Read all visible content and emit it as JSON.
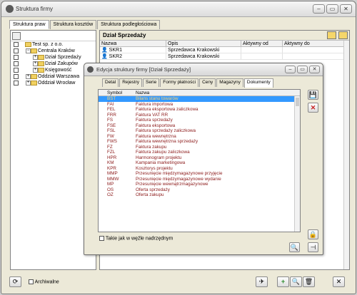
{
  "window": {
    "title": "Struktura firmy",
    "controls": [
      "–",
      "▭",
      "✕"
    ]
  },
  "tabs": [
    "Struktura praw",
    "Struktura kosztów",
    "Struktura podległościowa"
  ],
  "tree": [
    {
      "label": "Test sp. z o.o.",
      "level": 0,
      "expander": ""
    },
    {
      "label": "Centrala Kraków",
      "level": 1,
      "expander": "−"
    },
    {
      "label": "Dział Sprzedaży",
      "level": 2,
      "expander": "+"
    },
    {
      "label": "Dział Zakupów",
      "level": 2,
      "expander": "+"
    },
    {
      "label": "Księgowość",
      "level": 2,
      "expander": "+"
    },
    {
      "label": "Oddział Warszawa",
      "level": 1,
      "expander": "+"
    },
    {
      "label": "Oddział Wrocław",
      "level": 1,
      "expander": "+"
    }
  ],
  "panel": {
    "title": "Dział Sprzedaży",
    "columns": [
      "Nazwa",
      "Opis",
      "Aktywny od",
      "Aktywny do"
    ],
    "rows": [
      {
        "name": "SKR1",
        "desc": "Sprzedawca Krakowski",
        "from": "",
        "to": ""
      },
      {
        "name": "SKR2",
        "desc": "Sprzedawca Krakowski",
        "from": "",
        "to": ""
      }
    ]
  },
  "footer": {
    "archive_label": "Archiwalne"
  },
  "dialog": {
    "title": "Edycja struktury firmy [Dział Sprzedaży]",
    "tabs": [
      "Detal",
      "Rejestry",
      "Serie",
      "Formy płatności",
      "Ceny",
      "Magazyny",
      "Dokumenty"
    ],
    "active_tab": "Dokumenty",
    "columns": [
      "Symbol",
      "Nazwa"
    ],
    "rows": [
      {
        "symbol": "BST",
        "name": "Bilans stanu towarów",
        "selected": true
      },
      {
        "symbol": "FAI",
        "name": "Faktura importowa"
      },
      {
        "symbol": "FEL",
        "name": "Faktura eksportowa zaliczkowa"
      },
      {
        "symbol": "FRR",
        "name": "Faktura VAT RR"
      },
      {
        "symbol": "FS",
        "name": "Faktura sprzedaży"
      },
      {
        "symbol": "FSE",
        "name": "Faktura eksportowa"
      },
      {
        "symbol": "FSL",
        "name": "Faktura sprzedaży zaliczkowa"
      },
      {
        "symbol": "FW",
        "name": "Faktura wewnętrzna"
      },
      {
        "symbol": "FWS",
        "name": "Faktura wewnętrzna sprzedaży"
      },
      {
        "symbol": "FZ",
        "name": "Faktura zakupu"
      },
      {
        "symbol": "FZL",
        "name": "Faktura zakupu zaliczkowa"
      },
      {
        "symbol": "HPR",
        "name": "Harmonogram projektu"
      },
      {
        "symbol": "KM",
        "name": "Kampania marketingowa"
      },
      {
        "symbol": "KPR",
        "name": "Kosztorys projektu"
      },
      {
        "symbol": "MMP",
        "name": "Przesunięcie międzymagazynowe przyjęcie"
      },
      {
        "symbol": "MMW",
        "name": "Przesunięcie międzymagazynowe wydanie"
      },
      {
        "symbol": "MP",
        "name": "Przesunięcie wewnątrzmagazynowe"
      },
      {
        "symbol": "OS",
        "name": "Oferta sprzedaży"
      },
      {
        "symbol": "OZ",
        "name": "Oferta zakupu"
      }
    ],
    "inherit_label": "Takie jak w węźle nadrzędnym"
  }
}
